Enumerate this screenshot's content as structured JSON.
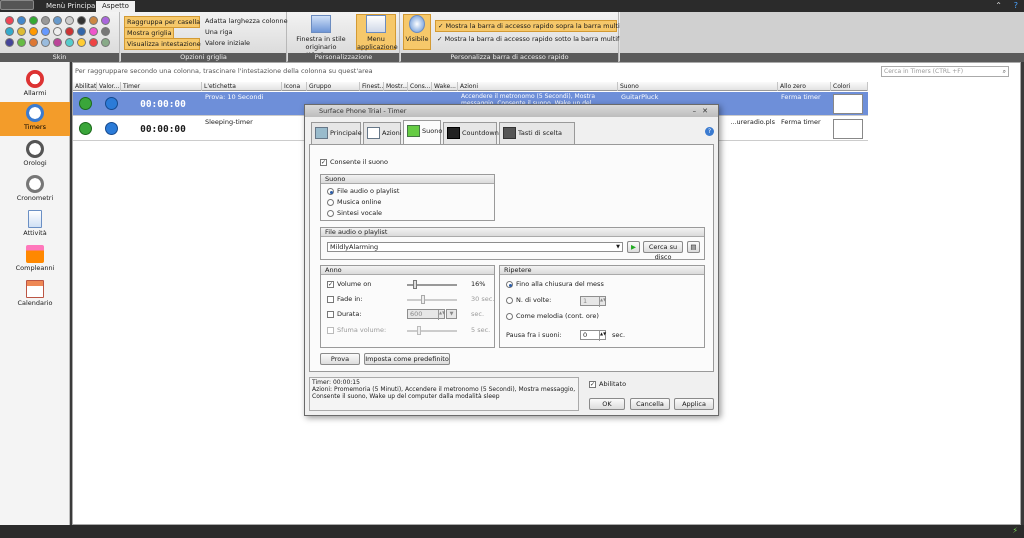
{
  "tabs": {
    "main_menu": "Menù Principale",
    "appearance": "Aspetto"
  },
  "ribbon": {
    "skin_label": "Skin",
    "grid_options_label": "Opzioni griglia",
    "group_by_box": "Raggruppa per casella",
    "show_grid": "Mostra griglia",
    "show_header": "Visualizza intestazione",
    "fit_columns": "Adatta larghezza colonne",
    "one_row": "Una riga",
    "initial_value": "Valore iniziale",
    "personalization_label": "Personalizzazione",
    "window_style": "Finestra in stile originario Windows",
    "menu_app": "Menu applicazione",
    "quick_access_label": "Personalizza barra di accesso rapido",
    "visible": "Visibile",
    "show_above": "Mostra la barra di accesso rapido sopra la barra multifunzione",
    "show_below": "Mostra la barra di accesso rapido sotto la barra multifunzione"
  },
  "nav": [
    {
      "label": "Allarmi",
      "icon": "alarm-clock-icon"
    },
    {
      "label": "Timers",
      "icon": "timer-icon"
    },
    {
      "label": "Orologi",
      "icon": "clock-icon"
    },
    {
      "label": "Cronometri",
      "icon": "stopwatch-icon"
    },
    {
      "label": "Attività",
      "icon": "task-list-icon"
    },
    {
      "label": "Compleanni",
      "icon": "birthday-cake-icon"
    },
    {
      "label": "Calendario",
      "icon": "calendar-icon"
    }
  ],
  "grid": {
    "group_hint": "Per raggruppare secondo una colonna, trascinare l'intestazione della colonna su quest'area",
    "search_placeholder": "Cerca in Timers (CTRL +F)",
    "columns": [
      "Abilitato",
      "Valor...",
      "Timer",
      "L'etichetta",
      "Icona",
      "Gruppo",
      "Finest...",
      "Mostr...",
      "Cons...",
      "Wake...",
      "Azioni",
      "Suono",
      "Allo zero",
      "Colori"
    ],
    "rows": [
      {
        "time": "00:00:00",
        "label": "Prova: 10 Secondi",
        "actions": "Accendere il metronomo (5 Secondi), Mostra messaggio, Consente il suono, Wake up del computer dalla modalità sleep",
        "sound": "GuitarPluck",
        "zero": "Ferma timer"
      },
      {
        "time": "00:00:00",
        "label": "Sleeping-timer",
        "actions": "",
        "sound": "...ureradio.pls",
        "zero": "Ferma timer"
      }
    ]
  },
  "dialog": {
    "title": "Surface Phone Trial - Timer",
    "tabs": [
      "Principale",
      "Azioni",
      "Suono",
      "Countdown",
      "Tasti di scelta rapida"
    ],
    "enable_sound": "Consente il suono",
    "sound_group": "Suono",
    "sound_options": [
      "File audio o playlist",
      "Musica online",
      "Sintesi vocale"
    ],
    "file_group": "File audio o playlist",
    "file_value": "MildlyAlarming",
    "browse": "Cerca su disco",
    "anno_group": "Anno",
    "volume_on": "Volume on",
    "volume_pct": "16%",
    "fade_in": "Fade in:",
    "fade_sec": "30 sec.",
    "duration": "Durata:",
    "duration_val": "600",
    "duration_unit": "sec.",
    "fade_volume": "Sfuma volume:",
    "fade_volume_sec": "5 sec.",
    "repeat_group": "Ripetere",
    "repeat_options": [
      "Fino alla chiusura del mess",
      "N. di volte:",
      "Come melodia (cont. ore)"
    ],
    "times_val": "1",
    "pause_label": "Pausa fra i suoni:",
    "pause_val": "0",
    "pause_unit": "sec.",
    "test": "Prova",
    "set_default": "Imposta come predefinito",
    "summary": "Timer: 00:00:15\nAzioni: Promemoria (5 Minuti), Accendere il metronomo (5 Secondi), Mostra messaggio, Consente il suono, Wake up del computer dalla modalità sleep",
    "enabled": "Abilitato",
    "ok": "OK",
    "cancel": "Cancella",
    "apply": "Applica"
  },
  "colors": {
    "accent": "#f39c2a",
    "selection": "#6e8fd9",
    "ribbon_dark": "#5a5a5a"
  }
}
